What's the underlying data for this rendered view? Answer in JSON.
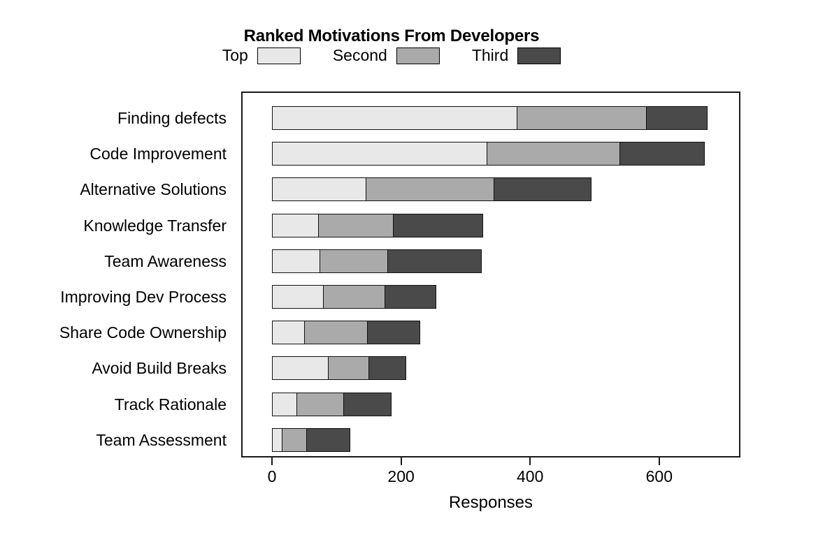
{
  "chart_data": {
    "type": "bar",
    "orientation": "horizontal",
    "stacked": true,
    "title": "Ranked Motivations From Developers",
    "xlabel": "Responses",
    "ylabel": "",
    "xlim": [
      0,
      700
    ],
    "xticks": [
      0,
      200,
      400,
      600
    ],
    "xtick_labels": [
      "0",
      "200",
      "400",
      "600"
    ],
    "grid": false,
    "legend_position": "top-center",
    "categories": [
      "Finding defects",
      "Code Improvement",
      "Alternative Solutions",
      "Knowledge Transfer",
      "Team Awareness",
      "Improving Dev Process",
      "Share Code Ownership",
      "Avoid Build Breaks",
      "Track Rationale",
      "Team Assessment"
    ],
    "series": [
      {
        "name": "Top",
        "color": "#e8e8e8",
        "values": [
          380,
          334,
          146,
          73,
          75,
          80,
          51,
          88,
          39,
          16
        ]
      },
      {
        "name": "Second",
        "color": "#aaaaaa",
        "values": [
          203,
          208,
          201,
          118,
          107,
          98,
          99,
          65,
          75,
          40
        ]
      },
      {
        "name": "Third",
        "color": "#4a4a4a",
        "values": [
          96,
          133,
          152,
          140,
          147,
          80,
          84,
          59,
          75,
          69
        ]
      }
    ],
    "totals": [
      679,
      675,
      499,
      331,
      329,
      258,
      234,
      212,
      189,
      125
    ]
  },
  "legend": {
    "entries": [
      {
        "label": "Top",
        "color": "#e8e8e8"
      },
      {
        "label": "Second",
        "color": "#aaaaaa"
      },
      {
        "label": "Third",
        "color": "#4a4a4a"
      }
    ]
  },
  "axis": {
    "x_title": "Responses",
    "tick_labels": [
      "0",
      "200",
      "400",
      "600"
    ]
  }
}
